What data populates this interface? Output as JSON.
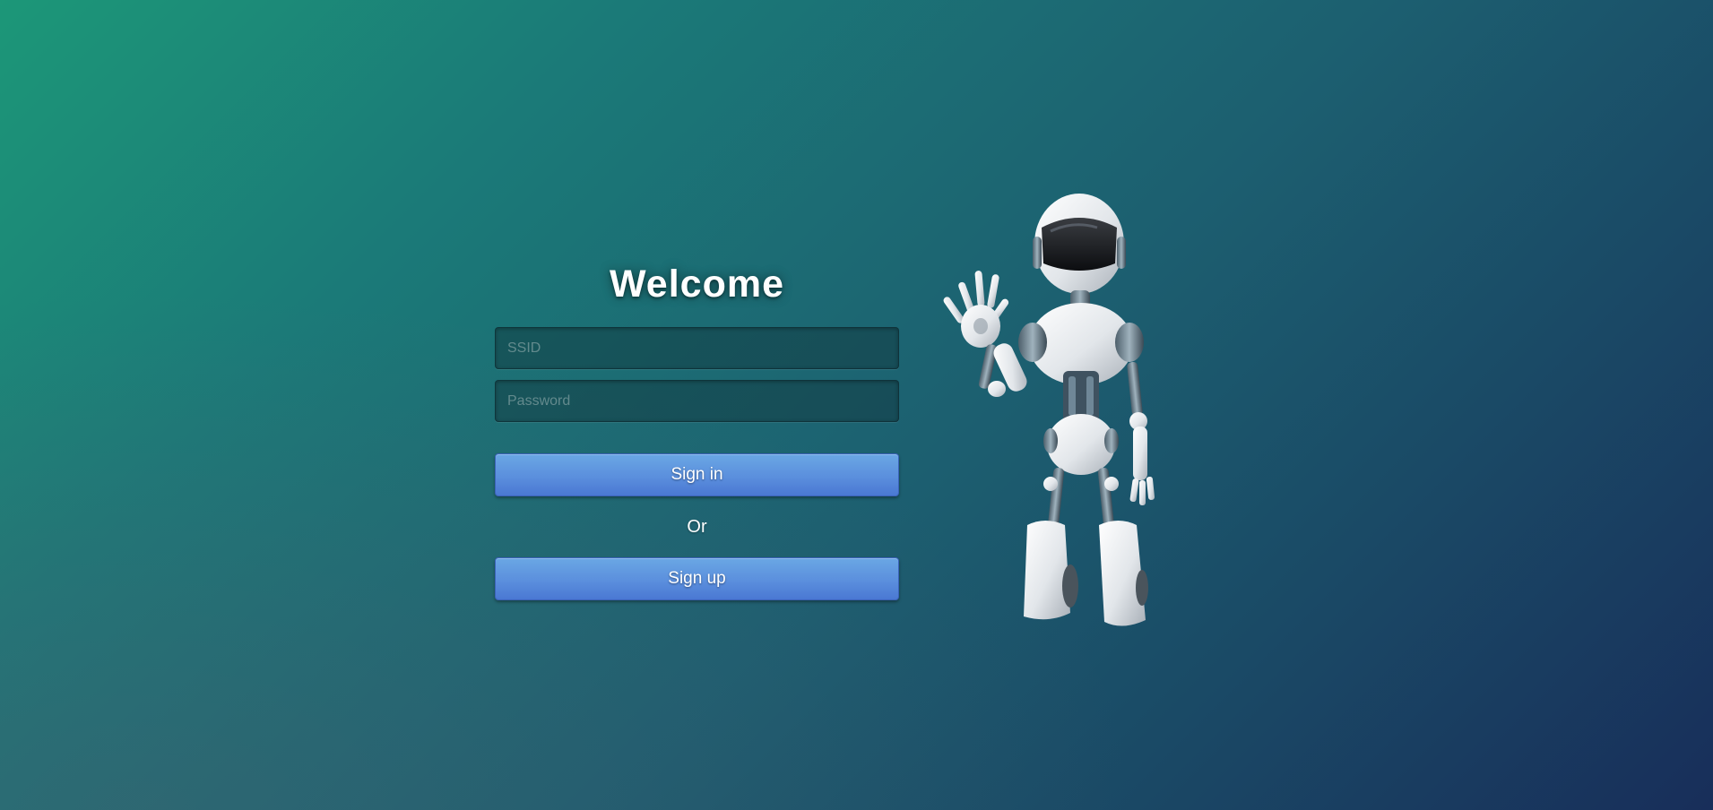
{
  "login": {
    "title": "Welcome",
    "ssid_placeholder": "SSID",
    "password_placeholder": "Password",
    "signin_label": "Sign in",
    "or_label": "Or",
    "signup_label": "Sign up"
  },
  "illustration": {
    "icon": "waving-robot-illustration"
  },
  "colors": {
    "background_start": "#1c9778",
    "background_end": "#182e5a",
    "button": "#5b8fdd",
    "field_bg": "#1d4b50"
  }
}
